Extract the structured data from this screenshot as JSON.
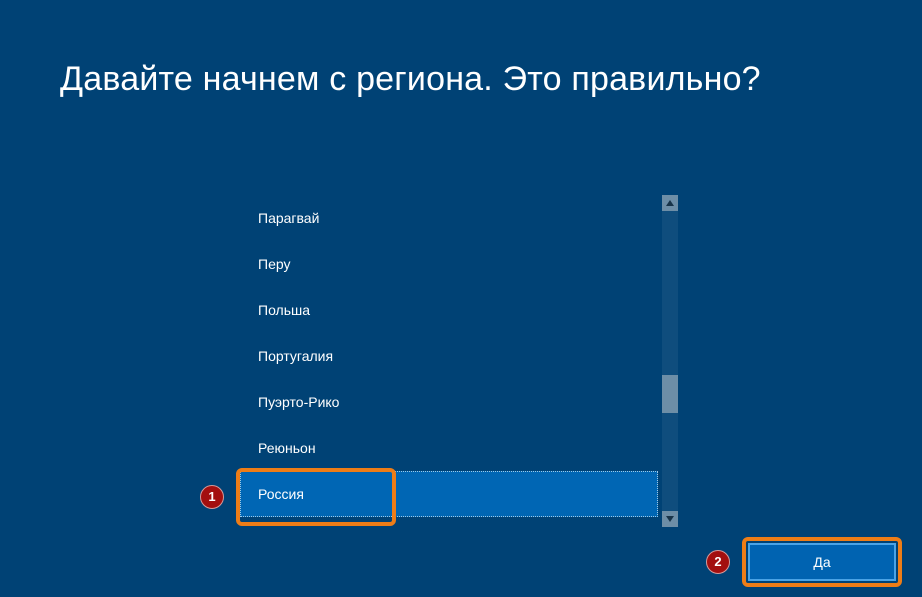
{
  "title": "Давайте начнем с региона. Это правильно?",
  "regions": {
    "items": [
      {
        "label": "Парагвай",
        "selected": false
      },
      {
        "label": "Перу",
        "selected": false
      },
      {
        "label": "Польша",
        "selected": false
      },
      {
        "label": "Португалия",
        "selected": false
      },
      {
        "label": "Пуэрто-Рико",
        "selected": false
      },
      {
        "label": "Реюньон",
        "selected": false
      },
      {
        "label": "Россия",
        "selected": true
      }
    ]
  },
  "buttons": {
    "yes": "Да"
  },
  "annotations": {
    "badge1": "1",
    "badge2": "2"
  },
  "colors": {
    "background": "#004275",
    "selected_row": "#0066b4",
    "button_bg": "#0063b1",
    "button_border": "#4aa3e6",
    "annotation_orange": "#ee7d17",
    "annotation_badge": "#a30f0f"
  }
}
